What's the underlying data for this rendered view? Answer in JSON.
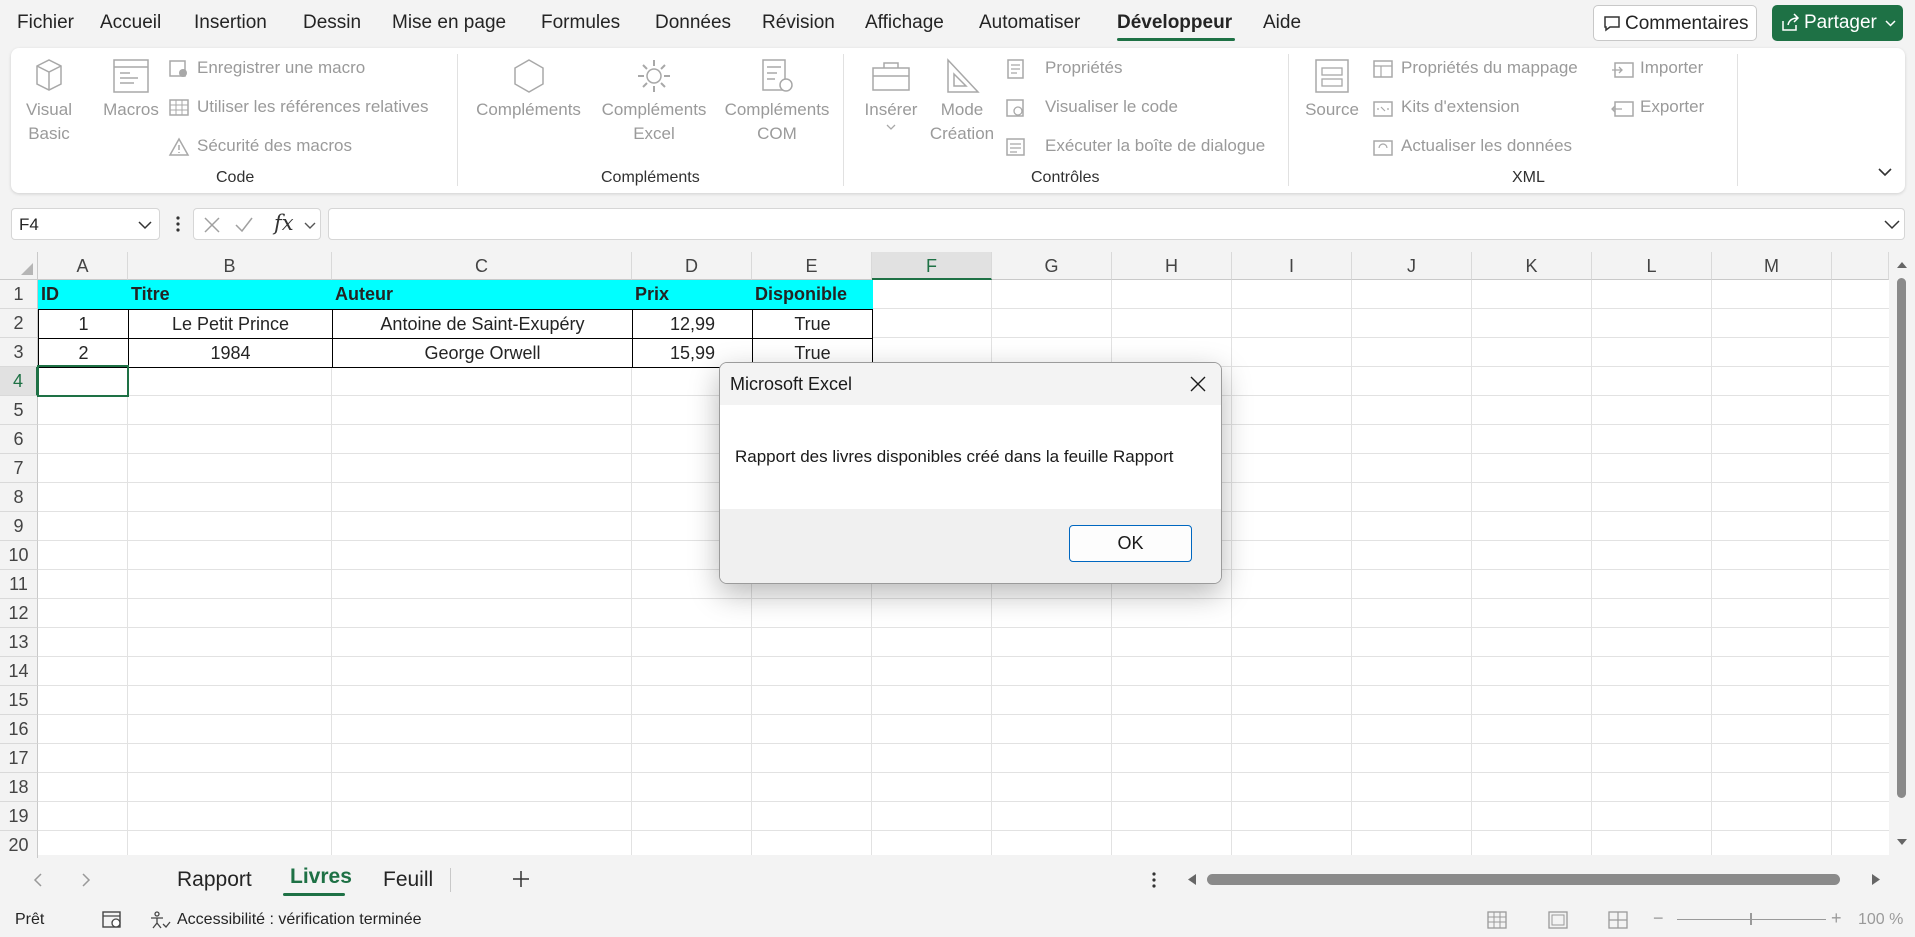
{
  "menu": {
    "items": [
      "Fichier",
      "Accueil",
      "Insertion",
      "Dessin",
      "Mise en page",
      "Formules",
      "Données",
      "Révision",
      "Affichage",
      "Automatiser",
      "Développeur",
      "Aide"
    ],
    "active": "Développeur",
    "comments_label": "Commentaires",
    "share_label": "Partager"
  },
  "ribbon": {
    "code": {
      "visual_basic": [
        "Visual",
        "Basic"
      ],
      "macros": "Macros",
      "record_macro": "Enregistrer une macro",
      "relative_refs": "Utiliser les références relatives",
      "macro_security": "Sécurité des macros",
      "label": "Code"
    },
    "addins": {
      "complements": "Compléments",
      "excel_addins": [
        "Compléments",
        "Excel"
      ],
      "com_addins": [
        "Compléments",
        "COM"
      ],
      "label": "Compléments"
    },
    "controls": {
      "insert": "Insérer",
      "design_mode": [
        "Mode",
        "Création"
      ],
      "properties": "Propriétés",
      "view_code": "Visualiser le code",
      "run_dialog": "Exécuter la boîte de dialogue",
      "label": "Contrôles"
    },
    "xml": {
      "source": "Source",
      "map_properties": "Propriétés du mappage",
      "expansion_packs": "Kits d'extension",
      "refresh_data": "Actualiser les données",
      "import": "Importer",
      "export": "Exporter",
      "label": "XML"
    }
  },
  "formula_bar": {
    "name_box": "F4",
    "fx": "fx",
    "formula": ""
  },
  "grid": {
    "columns": [
      "A",
      "B",
      "C",
      "D",
      "E",
      "F",
      "G",
      "H",
      "I",
      "J",
      "K",
      "L",
      "M"
    ],
    "selected_column": "F",
    "rows": [
      "1",
      "2",
      "3",
      "4",
      "5",
      "6",
      "7",
      "8",
      "9",
      "10",
      "11",
      "12",
      "13",
      "14",
      "15",
      "16",
      "17",
      "18",
      "19",
      "20"
    ],
    "selected_row": "4",
    "headers": [
      "ID",
      "Titre",
      "Auteur",
      "Prix",
      "Disponible"
    ],
    "data": [
      [
        "1",
        "Le Petit Prince",
        "Antoine de Saint-Exupéry",
        "12,99",
        "True"
      ],
      [
        "2",
        "1984",
        "George Orwell",
        "15,99",
        "True"
      ]
    ]
  },
  "sheets": {
    "tabs": [
      "Rapport",
      "Livres",
      "Feuill"
    ],
    "active": "Livres"
  },
  "status": {
    "ready": "Prêt",
    "accessibility": "Accessibilité : vérification terminée",
    "zoom": "100 %"
  },
  "dialog": {
    "title": "Microsoft Excel",
    "message": "Rapport des livres disponibles créé dans la feuille Rapport",
    "ok_label": "OK"
  },
  "colors": {
    "accent": "#1e7145",
    "header_fill": "#00ffff"
  }
}
